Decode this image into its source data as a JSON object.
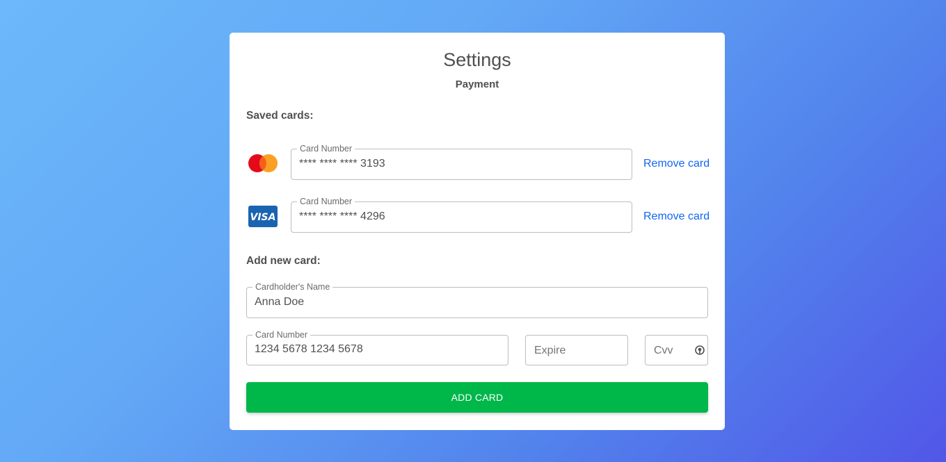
{
  "header": {
    "title": "Settings",
    "subtitle": "Payment"
  },
  "saved_cards": {
    "section_label": "Saved cards:",
    "items": [
      {
        "brand": "mastercard-icon",
        "field_label": "Card Number",
        "value": "**** **** **** 3193",
        "remove_label": "Remove card"
      },
      {
        "brand": "visa-icon",
        "brand_text": "VISA",
        "field_label": "Card Number",
        "value": "**** **** **** 4296",
        "remove_label": "Remove card"
      }
    ]
  },
  "new_card": {
    "section_label": "Add new card:",
    "name_label": "Cardholder's Name",
    "name_value": "Anna Doe",
    "number_label": "Card Number",
    "number_value": "1234 5678 1234 5678",
    "expire_placeholder": "Expire",
    "cvv_placeholder": "Cvv",
    "cvv_icon": "info-icon",
    "submit_label": "ADD CARD"
  },
  "colors": {
    "accent_link": "#1266f1",
    "submit_button": "#00b74a",
    "mastercard_red": "#e30b1a",
    "mastercard_orange": "#f9a022",
    "visa_blue": "#1a63b0"
  }
}
